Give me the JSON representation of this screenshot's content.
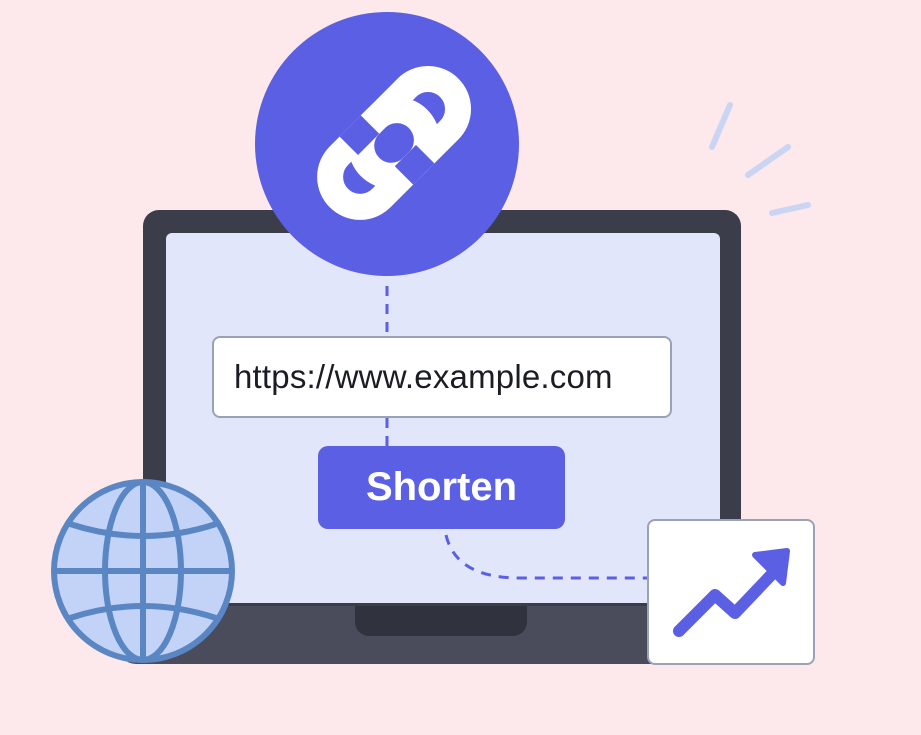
{
  "url_input": {
    "value": "https://www.example.com"
  },
  "shorten_button": {
    "label": "Shorten"
  },
  "icons": {
    "link": "link-icon",
    "globe": "globe-icon",
    "analytics": "trending-up-icon"
  },
  "colors": {
    "background": "#fde8ec",
    "accent": "#5b5fe3",
    "laptop_frame": "#3b3d4a",
    "screen": "#e2e6fb",
    "globe_fill": "#c3d3f7",
    "globe_stroke": "#5a86c4"
  }
}
